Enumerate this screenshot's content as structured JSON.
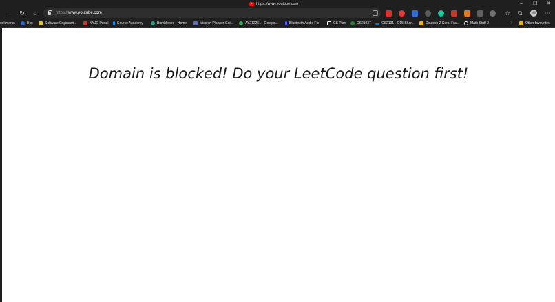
{
  "window": {
    "tab_title": "https://www.youtube.com",
    "controls": {
      "minimize": "–",
      "restore": "❐",
      "close": "✕"
    }
  },
  "toolbar": {
    "url_scheme": "https://",
    "url_host": "www.youtube.com",
    "icons": [
      "forward-icon",
      "refresh-icon",
      "home-icon",
      "lock-icon",
      "app-available-icon",
      "favorites-icon",
      "collections-icon",
      "profile-avatar",
      "more-icon"
    ]
  },
  "extensions": [
    {
      "name": "extension-red-1",
      "color": "#d9302c"
    },
    {
      "name": "extension-red-badge",
      "color": "#e53935"
    },
    {
      "name": "extension-blue",
      "color": "#2f6fd1"
    },
    {
      "name": "extension-gray-1",
      "color": "#5a5a5a"
    },
    {
      "name": "extension-green",
      "color": "#16c79a"
    },
    {
      "name": "extension-red-2",
      "color": "#c0392b"
    },
    {
      "name": "extension-orange",
      "color": "#e07a1f"
    },
    {
      "name": "extension-gray-2",
      "color": "#5f5f5f"
    },
    {
      "name": "extension-gray-3",
      "color": "#707070"
    }
  ],
  "bookmarks": {
    "items": [
      {
        "label": "ookmarks",
        "color": "#6b6b6b"
      },
      {
        "label": "Box",
        "color": "#2f6fd1"
      },
      {
        "label": "Software Engineeri...",
        "color": "#e0c14a"
      },
      {
        "label": "NYJC Portal",
        "color": "#c0392b"
      },
      {
        "label": "Source Academy",
        "color": "#1e88e5"
      },
      {
        "label": "Bumblebee - Home",
        "color": "#2a9d8f"
      },
      {
        "label": "Mission Planner Gui...",
        "color": "#5c6bc0"
      },
      {
        "label": "AY212251 - Google...",
        "color": "#34a853"
      },
      {
        "label": "Bluetooth Audio Fix",
        "color": "#3d5afe"
      },
      {
        "label": "CS Plan",
        "color": "#ffffff"
      },
      {
        "label": "CS2103T",
        "color": "#2e7d32"
      },
      {
        "label": "CS2101 - G15 Shar...",
        "color": "#0078d4"
      },
      {
        "label": "Deutsch 2-Kurs: Fra...",
        "color": "#f4b400"
      },
      {
        "label": "Math Stuff 2",
        "color": "#111111"
      }
    ],
    "other": {
      "label": "Other favourites",
      "color": "#e6b422"
    }
  },
  "page": {
    "message": "Domain is blocked! Do your LeetCode question first!"
  }
}
